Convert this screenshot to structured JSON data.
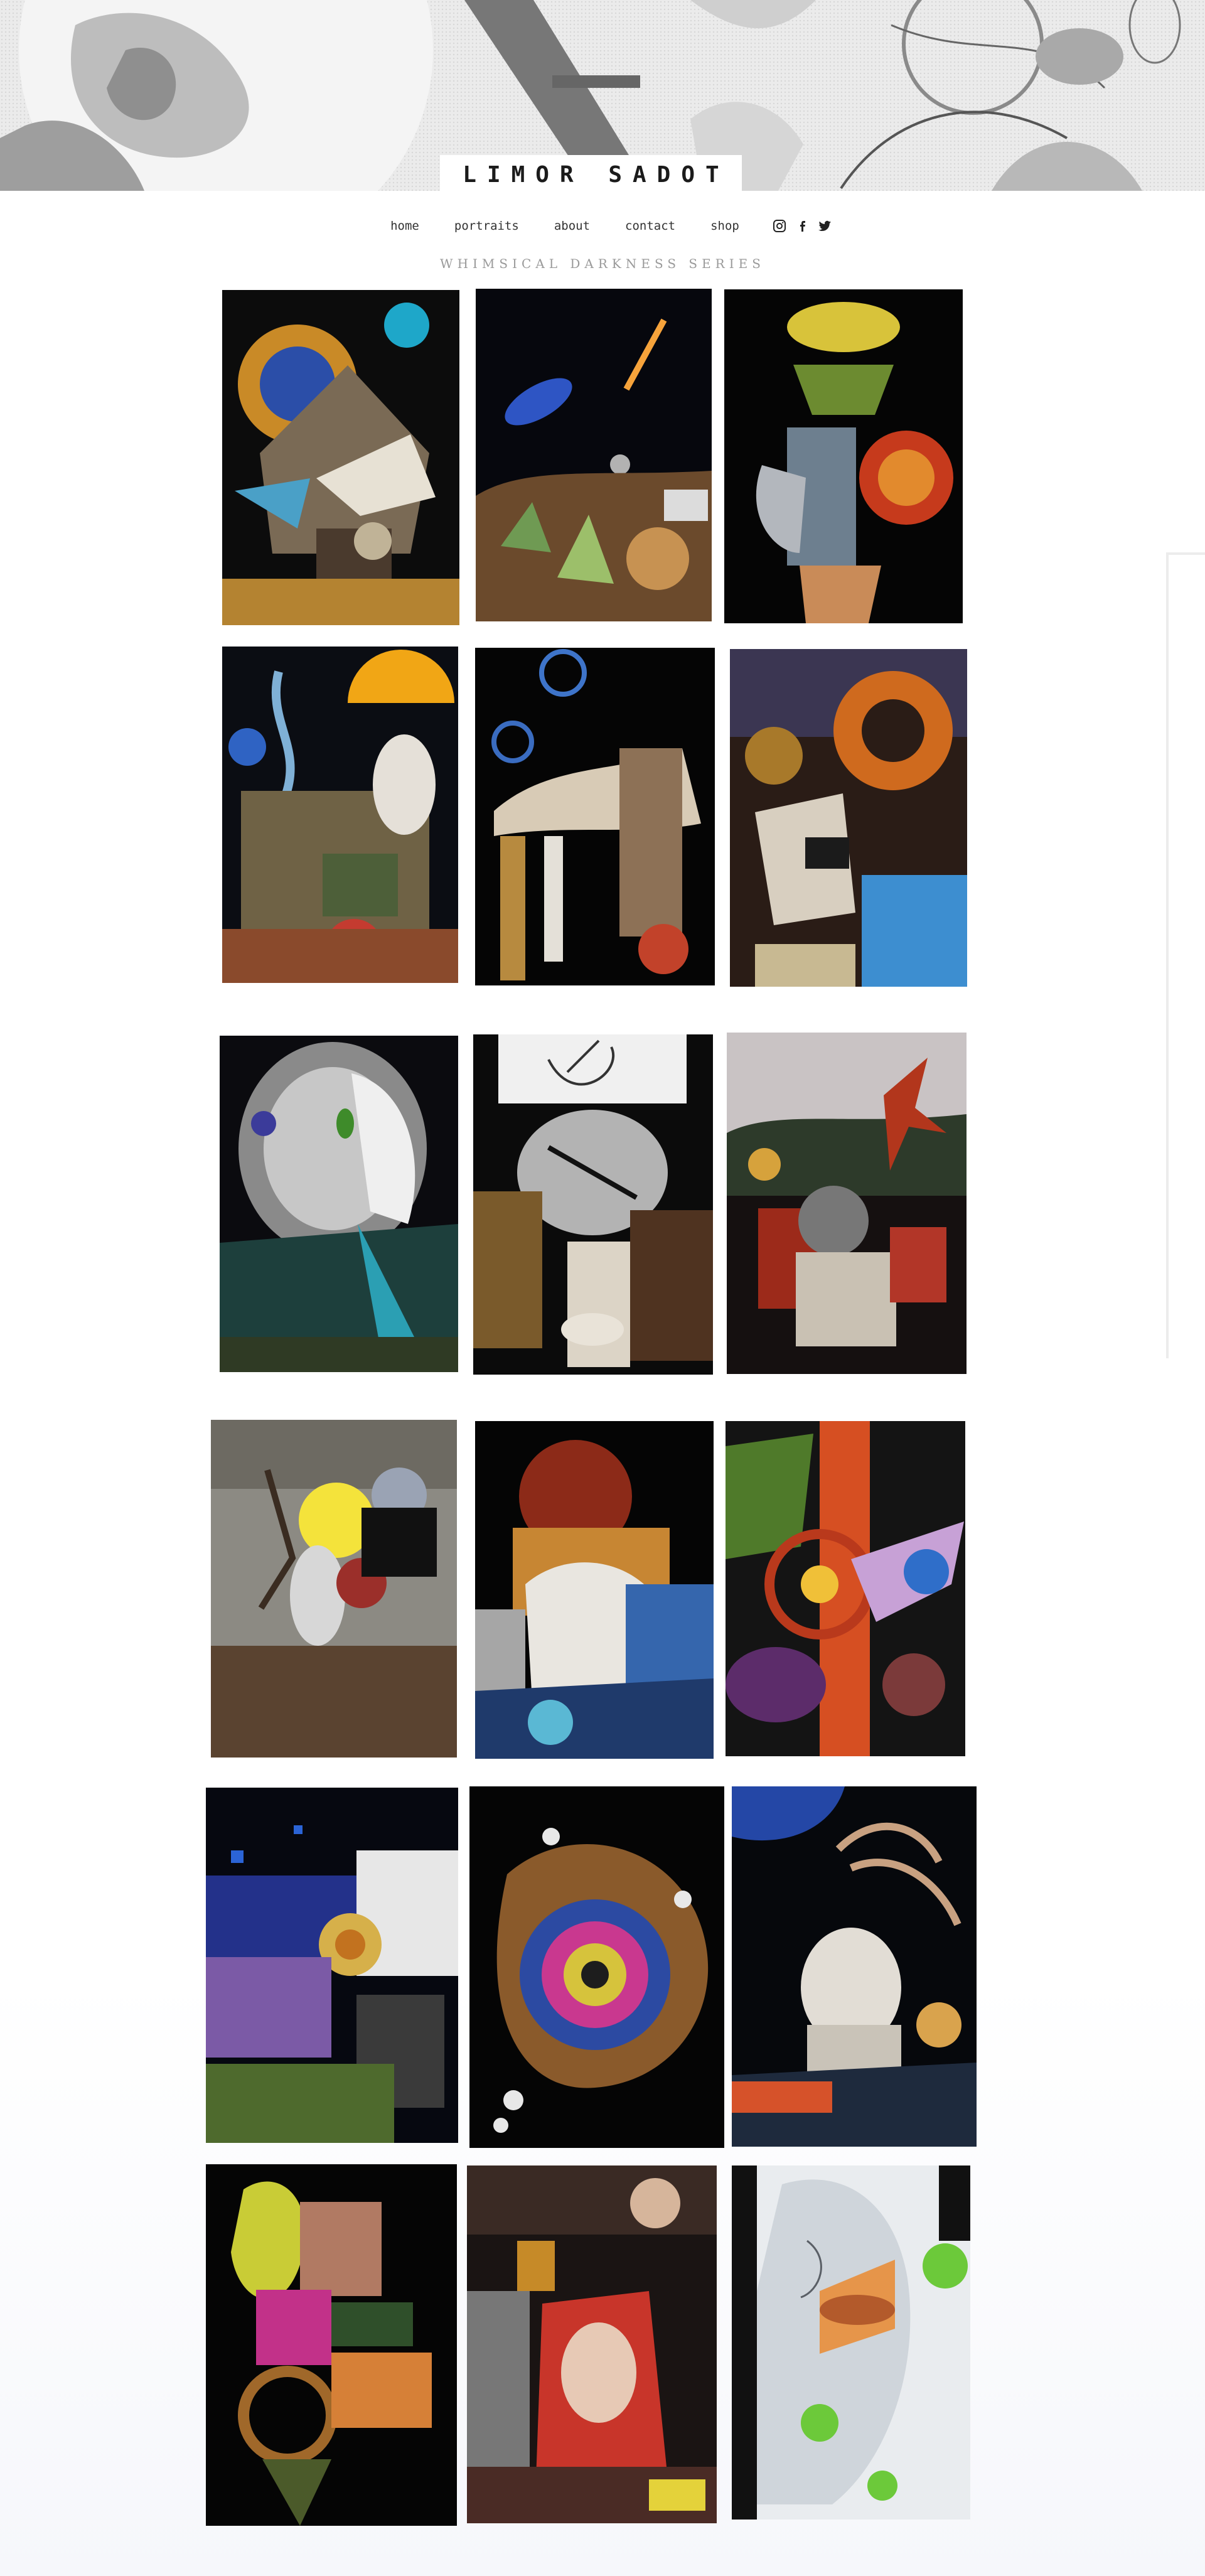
{
  "site": {
    "brand": "LIMOR SADOT",
    "nav": [
      "home",
      "portraits",
      "about",
      "contact",
      "shop"
    ],
    "social": [
      {
        "name": "instagram-icon",
        "glyph": "◎"
      },
      {
        "name": "facebook-icon",
        "glyph": "f"
      },
      {
        "name": "twitter-icon",
        "glyph": "t"
      }
    ],
    "series_title": "WHIMSICAL DARKNESS SERIES"
  },
  "gallery": {
    "artworks_count": 18
  }
}
